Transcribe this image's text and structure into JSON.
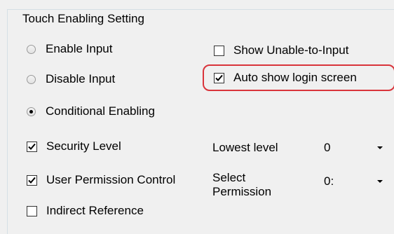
{
  "group": {
    "title": "Touch Enabling Setting"
  },
  "radios": {
    "enable_input": {
      "label": "Enable Input",
      "checked": false
    },
    "disable_input": {
      "label": "Disable Input",
      "checked": false
    },
    "conditional_enabling": {
      "label": "Conditional Enabling",
      "checked": true
    }
  },
  "checkboxes": {
    "show_unable": {
      "label": "Show Unable-to-Input",
      "checked": false
    },
    "auto_show_login": {
      "label": "Auto show login screen",
      "checked": true
    },
    "security_level": {
      "label": "Security Level",
      "checked": true
    },
    "user_permission": {
      "label": "User Permission Control",
      "checked": true
    },
    "indirect_reference": {
      "label": "Indirect Reference",
      "checked": false
    }
  },
  "lowest_level": {
    "label": "Lowest level",
    "value": "0"
  },
  "select_permission": {
    "label_line1": "Select",
    "label_line2": "Permission",
    "value": "0:"
  },
  "colors": {
    "highlight": "#d9343b",
    "background": "#f0f0f0"
  }
}
